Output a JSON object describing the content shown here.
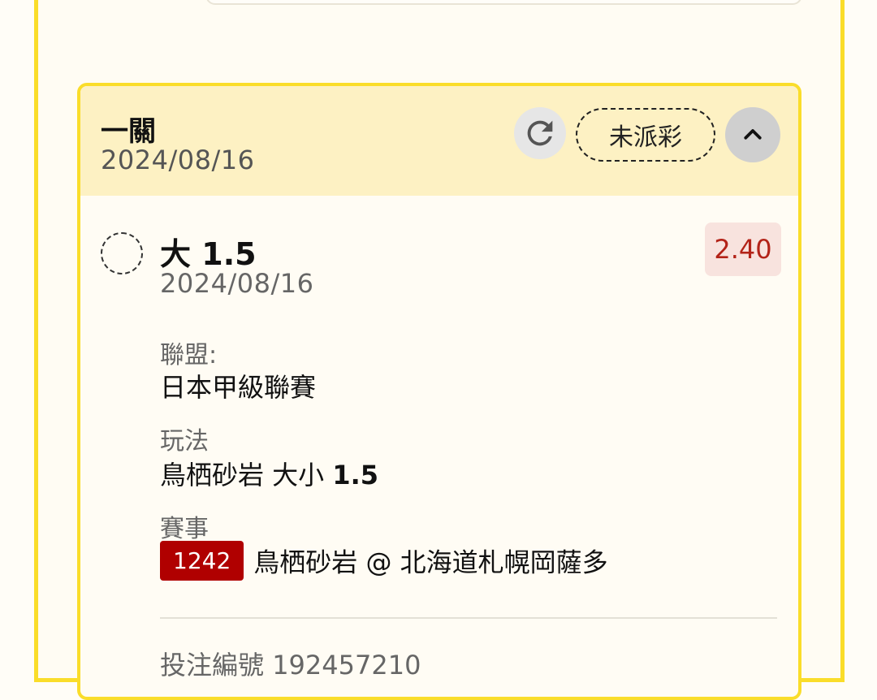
{
  "card": {
    "bet_type": "一關",
    "date": "2024/08/16",
    "status": "未派彩"
  },
  "selection": {
    "title_prefix": "大",
    "title_value": "1.5",
    "date": "2024/08/16",
    "odds": "2.40"
  },
  "details": {
    "league_label": "聯盟:",
    "league_value": "日本甲級聯賽",
    "play_label": "玩法",
    "play_value_text": "鳥栖砂岩 大小",
    "play_value_num": "1.5",
    "match_label": "賽事",
    "match_id": "1242",
    "match_name": "鳥栖砂岩 @ 北海道札幌岡薩多"
  },
  "reference": {
    "label": "投注編號",
    "value": "192457210"
  },
  "icons": {
    "refresh": "refresh-icon",
    "collapse": "chevron-up-icon"
  },
  "colors": {
    "accent_border": "#fadd2a",
    "header_bg": "#fdf1c3",
    "odds_text": "#b32318",
    "odds_bg": "#f8e3de",
    "match_id_bg": "#b00000"
  }
}
